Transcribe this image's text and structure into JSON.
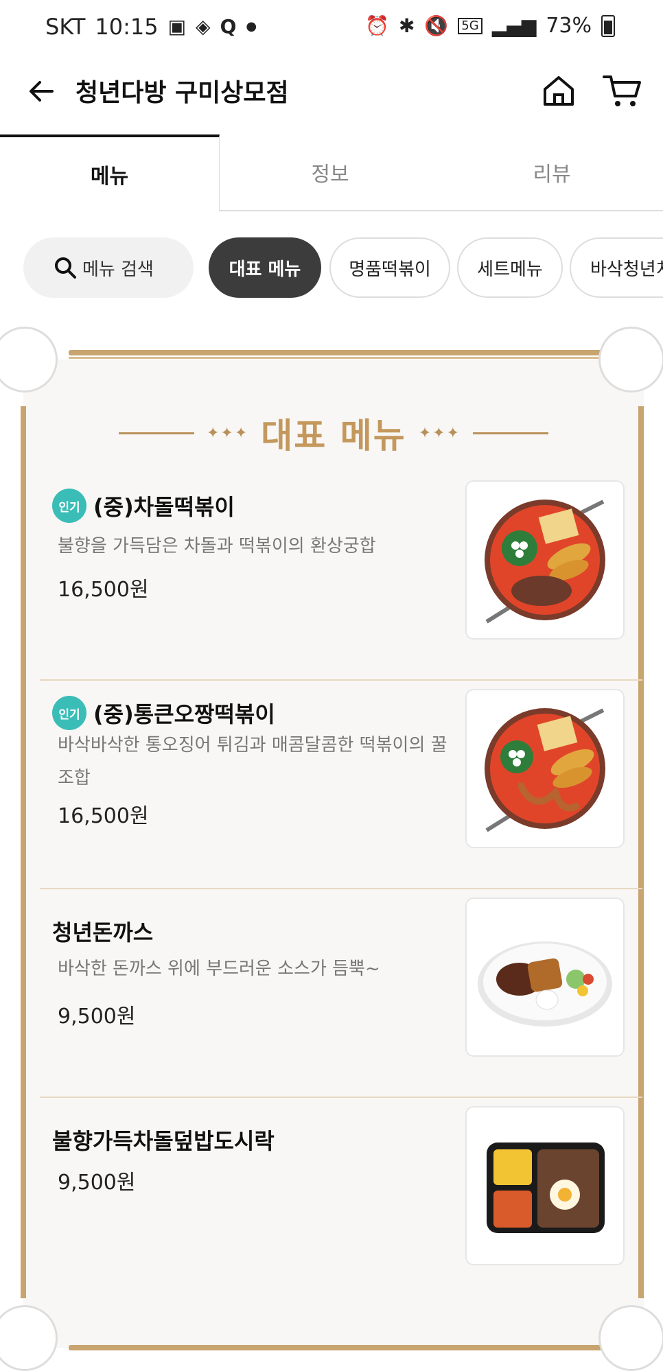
{
  "status_bar": {
    "carrier": "SKT",
    "time": "10:15",
    "network": "5G",
    "battery": "73%"
  },
  "header": {
    "title": "청년다방 구미상모점"
  },
  "tabs": [
    {
      "label": "메뉴",
      "active": true
    },
    {
      "label": "정보",
      "active": false
    },
    {
      "label": "리뷰",
      "active": false
    }
  ],
  "chips": {
    "search_label": "메뉴 검색",
    "items": [
      "대표 메뉴",
      "명품떡볶이",
      "세트메뉴",
      "바삭청년치"
    ]
  },
  "section": {
    "title": "대표 메뉴"
  },
  "menu_items": [
    {
      "badge": "인기",
      "name": "(중)차돌떡볶이",
      "description": "불향을 가득담은 차돌과 떡볶이의 환상궁합",
      "price": "16,500원"
    },
    {
      "badge": "인기",
      "name": "(중)통큰오짱떡볶이",
      "description": "바삭바삭한 통오징어 튀김과 매콤달콤한 떡볶이의 꿀조합",
      "price": "16,500원"
    },
    {
      "badge": "",
      "name": "청년돈까스",
      "description": "바삭한 돈까스 위에 부드러운 소스가 듬뿍~",
      "price": "9,500원"
    },
    {
      "badge": "",
      "name": "불향가득차돌덮밥도시락",
      "description": "",
      "price": "9,500원"
    }
  ],
  "colors": {
    "accent_gold": "#c4985c",
    "badge_teal": "#3bbdb7",
    "chip_selected": "#3c3c3c"
  }
}
